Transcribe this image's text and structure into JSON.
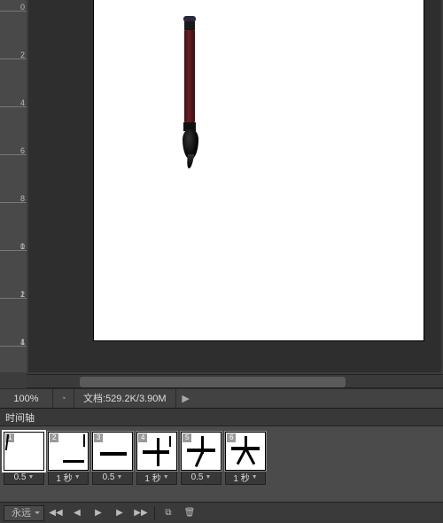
{
  "status": {
    "zoom": "100%",
    "doc_label": "文档:",
    "doc_info": "529.2K/3.90M"
  },
  "timeline": {
    "title": "时间轴",
    "loop_mode": "永远",
    "frames": [
      {
        "n": "1",
        "delay": "0.5",
        "selected": true
      },
      {
        "n": "2",
        "delay": "1 秒"
      },
      {
        "n": "3",
        "delay": "0.5"
      },
      {
        "n": "4",
        "delay": "1 秒"
      },
      {
        "n": "5",
        "delay": "0.5"
      },
      {
        "n": "6",
        "delay": "1 秒"
      }
    ]
  },
  "icons": {
    "preview": "◔",
    "play": "▶",
    "first": "◀◀",
    "prev": "◀",
    "next": "▶",
    "last": "▶▶",
    "dup": "⧉",
    "trash": "🗑"
  }
}
